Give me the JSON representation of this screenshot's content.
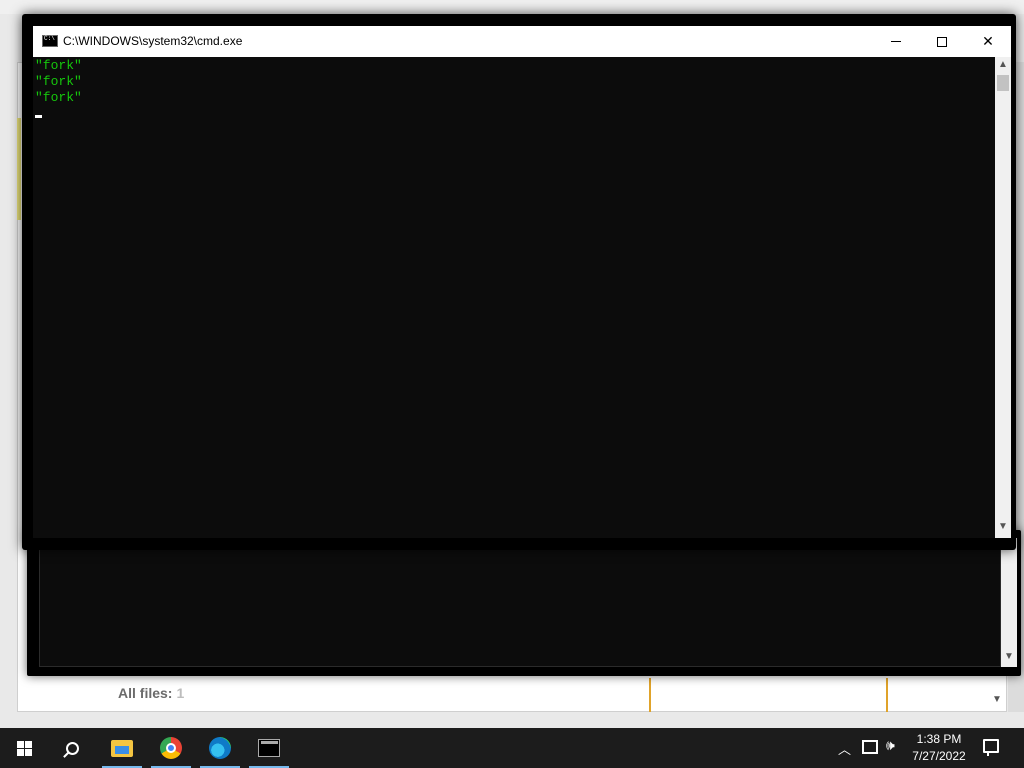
{
  "window": {
    "title": "C:\\WINDOWS\\system32\\cmd.exe"
  },
  "console": {
    "lines": [
      "\"fork\"",
      "\"fork\"",
      "\"fork\""
    ],
    "text_color": "#16c60c",
    "background": "#0c0c0c"
  },
  "background_app": {
    "all_files_label": "All files:",
    "all_files_count": "1"
  },
  "taskbar": {
    "time": "1:38 PM",
    "date": "7/27/2022",
    "accent": "#76b9ed",
    "icons": [
      "windows-start-icon",
      "search-icon",
      "file-explorer-icon",
      "chrome-icon",
      "edge-icon",
      "command-prompt-icon"
    ]
  }
}
